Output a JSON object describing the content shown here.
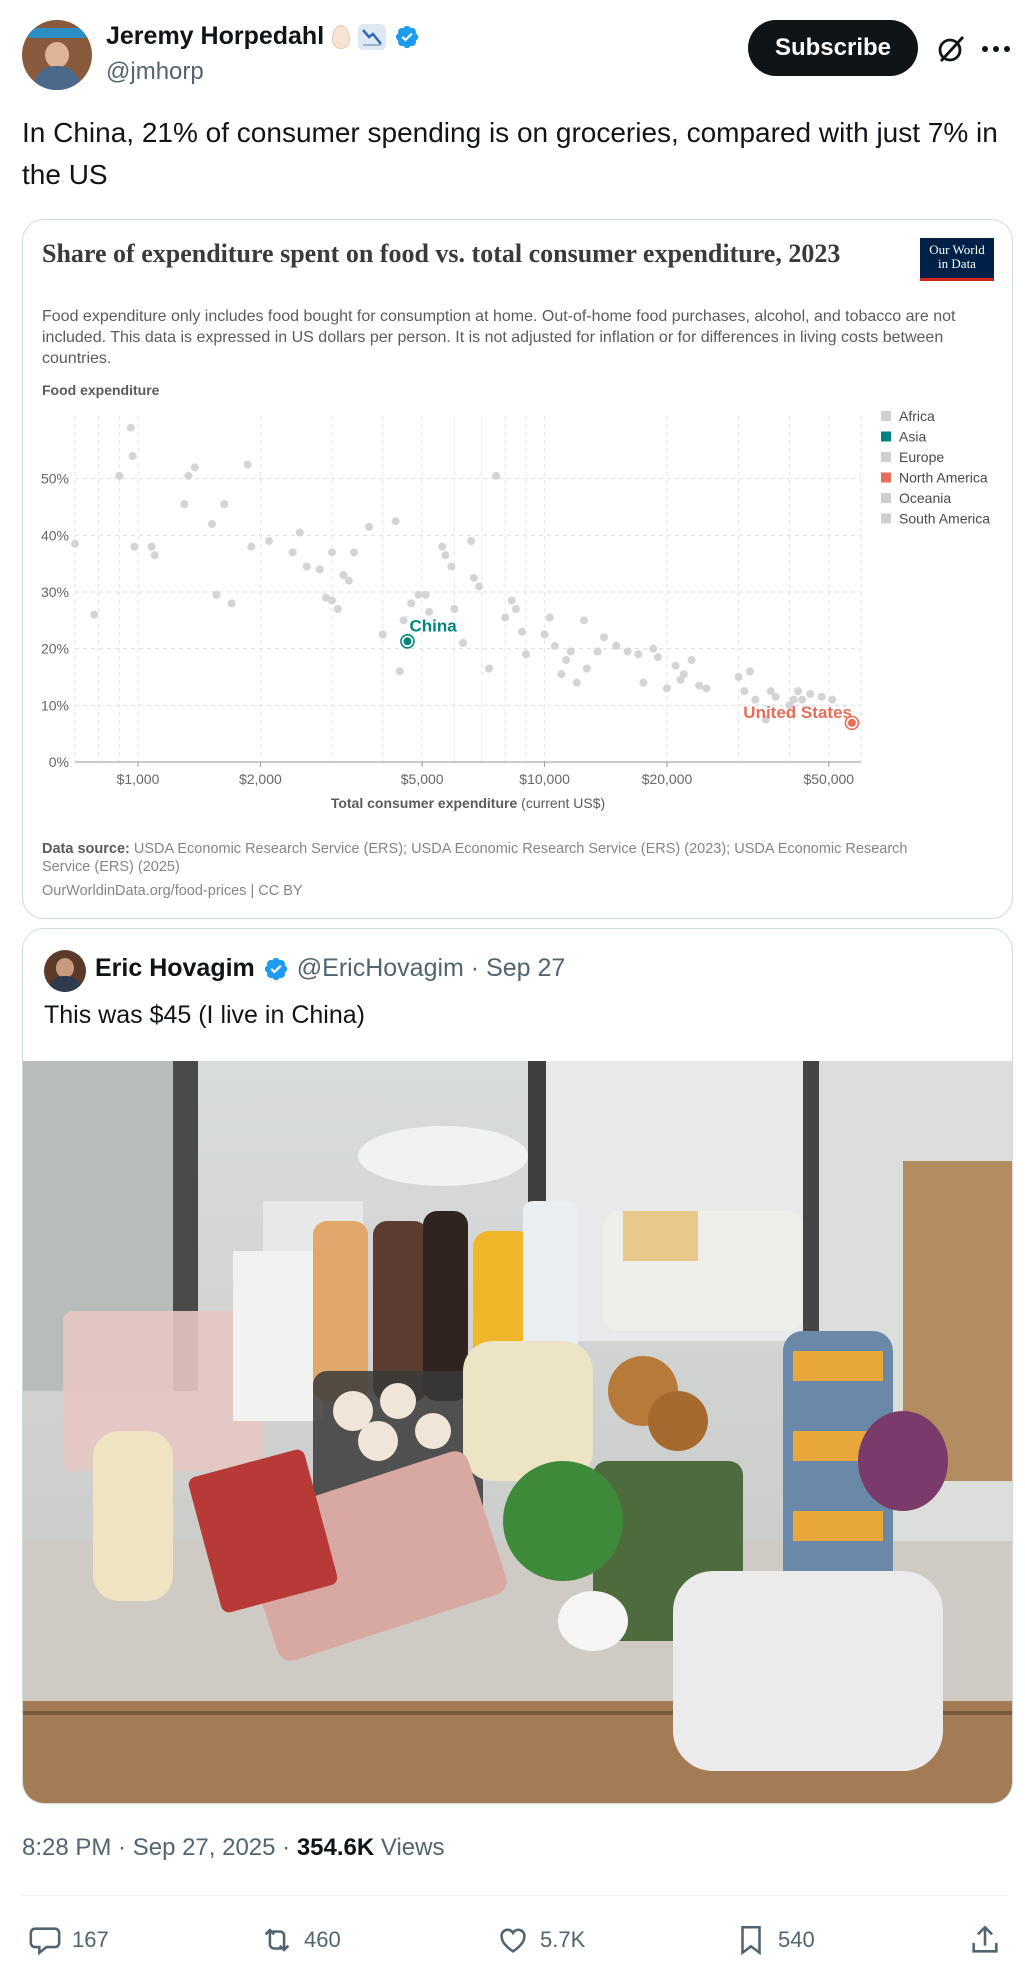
{
  "author": {
    "name": "Jeremy Horpedahl",
    "handle": "@jmhorp",
    "subscribe_label": "Subscribe"
  },
  "tweet_text": "In China, 21% of consumer spending is on groceries, compared with just 7% in the US",
  "chart_card": {
    "title": "Share of expenditure spent on food vs. total consumer expenditure, 2023",
    "logo_line1": "Our World",
    "logo_line2": "in Data",
    "subtitle": "Food expenditure only includes food bought for consumption at home. Out-of-home food purchases, alcohol, and tobacco are not included. This data is expressed in US dollars per person. It is not adjusted for inflation or for differences in living costs between countries.",
    "source_label": "Data source:",
    "source_text": "USDA Economic Research Service (ERS); USDA Economic Research Service (ERS) (2023); USDA Economic Research Service (ERS) (2025)",
    "url_text": "OurWorldinData.org/food-prices | CC BY"
  },
  "chart_data": {
    "type": "scatter",
    "title": "Share of expenditure spent on food vs. total consumer expenditure, 2023",
    "xlabel": "Total consumer expenditure (current US$)",
    "xlabel_bold": "Total consumer expenditure",
    "xlabel_unit": "(current US$)",
    "ylabel": "Food expenditure",
    "x_scale": "log",
    "xlim": [
      700,
      60000
    ],
    "ylim": [
      0,
      60
    ],
    "x_ticks": [
      {
        "value": 1000,
        "label": "$1,000"
      },
      {
        "value": 2000,
        "label": "$2,000"
      },
      {
        "value": 5000,
        "label": "$5,000"
      },
      {
        "value": 10000,
        "label": "$10,000"
      },
      {
        "value": 20000,
        "label": "$20,000"
      },
      {
        "value": 50000,
        "label": "$50,000"
      }
    ],
    "y_ticks": [
      {
        "value": 0,
        "label": "0%"
      },
      {
        "value": 10,
        "label": "10%"
      },
      {
        "value": 20,
        "label": "20%"
      },
      {
        "value": 30,
        "label": "30%"
      },
      {
        "value": 40,
        "label": "40%"
      },
      {
        "value": 50,
        "label": "50%"
      }
    ],
    "grid": true,
    "legend_position": "right",
    "legend": [
      {
        "name": "Africa",
        "color": "#cfcfcf"
      },
      {
        "name": "Asia",
        "color": "#00847e"
      },
      {
        "name": "Europe",
        "color": "#cfcfcf"
      },
      {
        "name": "North America",
        "color": "#e56e5a"
      },
      {
        "name": "Oceania",
        "color": "#cfcfcf"
      },
      {
        "name": "South America",
        "color": "#cfcfcf"
      }
    ],
    "highlighted": [
      {
        "name": "China",
        "x": 4600,
        "y": 21.3,
        "color": "#00847e"
      },
      {
        "name": "United States",
        "x": 57000,
        "y": 6.9,
        "color": "#e56e5a"
      }
    ],
    "other_points": [
      [
        700,
        38.5
      ],
      [
        780,
        26
      ],
      [
        900,
        50.5
      ],
      [
        960,
        59
      ],
      [
        970,
        54
      ],
      [
        980,
        38
      ],
      [
        1080,
        38
      ],
      [
        1100,
        36.5
      ],
      [
        1300,
        45.5
      ],
      [
        1330,
        50.5
      ],
      [
        1380,
        52
      ],
      [
        1520,
        42
      ],
      [
        1560,
        29.5
      ],
      [
        1630,
        45.5
      ],
      [
        1700,
        28
      ],
      [
        1860,
        52.5
      ],
      [
        1900,
        38
      ],
      [
        2100,
        39
      ],
      [
        2400,
        37
      ],
      [
        2500,
        40.5
      ],
      [
        2600,
        34.5
      ],
      [
        2800,
        34
      ],
      [
        2900,
        29
      ],
      [
        3000,
        37
      ],
      [
        3000,
        28.5
      ],
      [
        3100,
        27
      ],
      [
        3200,
        33
      ],
      [
        3300,
        32
      ],
      [
        3400,
        37
      ],
      [
        3700,
        41.5
      ],
      [
        4000,
        22.5
      ],
      [
        4300,
        42.5
      ],
      [
        4400,
        16
      ],
      [
        4500,
        25
      ],
      [
        4700,
        28
      ],
      [
        4900,
        29.5
      ],
      [
        5100,
        29.5
      ],
      [
        5200,
        26.5
      ],
      [
        5600,
        38
      ],
      [
        5700,
        36.5
      ],
      [
        5900,
        34.5
      ],
      [
        6000,
        27
      ],
      [
        6300,
        21
      ],
      [
        6600,
        39
      ],
      [
        6700,
        32.5
      ],
      [
        6900,
        31
      ],
      [
        7300,
        16.5
      ],
      [
        7600,
        50.5
      ],
      [
        8000,
        25.5
      ],
      [
        8300,
        28.5
      ],
      [
        8500,
        27
      ],
      [
        8800,
        23
      ],
      [
        9000,
        19
      ],
      [
        10000,
        22.5
      ],
      [
        10300,
        25.5
      ],
      [
        10600,
        20.5
      ],
      [
        11000,
        15.5
      ],
      [
        11300,
        18
      ],
      [
        11600,
        19.5
      ],
      [
        12000,
        14
      ],
      [
        12500,
        25
      ],
      [
        12700,
        16.5
      ],
      [
        13500,
        19.5
      ],
      [
        14000,
        22
      ],
      [
        15000,
        20.5
      ],
      [
        16000,
        19.5
      ],
      [
        17000,
        19
      ],
      [
        17500,
        14
      ],
      [
        18500,
        20
      ],
      [
        19000,
        18.5
      ],
      [
        20000,
        13
      ],
      [
        21000,
        17
      ],
      [
        21600,
        14.5
      ],
      [
        22000,
        15.5
      ],
      [
        23000,
        18
      ],
      [
        24000,
        13.5
      ],
      [
        25000,
        13
      ],
      [
        30000,
        15
      ],
      [
        31000,
        12.5
      ],
      [
        32000,
        16
      ],
      [
        33000,
        11
      ],
      [
        35000,
        7.5
      ],
      [
        36000,
        12.5
      ],
      [
        37000,
        11.5
      ],
      [
        40000,
        10
      ],
      [
        41000,
        11
      ],
      [
        42000,
        12.5
      ],
      [
        43000,
        11
      ],
      [
        45000,
        12
      ],
      [
        48000,
        11.5
      ],
      [
        51000,
        11
      ]
    ]
  },
  "quote": {
    "name": "Eric Hovagim",
    "meta": "@EricHovagim · Sep 27",
    "text": "This was $45 (I live in China)"
  },
  "timestamp": "8:28 PM · Sep 27, 2025 · ",
  "views_count": "354.6K",
  "views_label": " Views",
  "actions": {
    "replies": "167",
    "reposts": "460",
    "likes": "5.7K",
    "bookmarks": "540"
  }
}
